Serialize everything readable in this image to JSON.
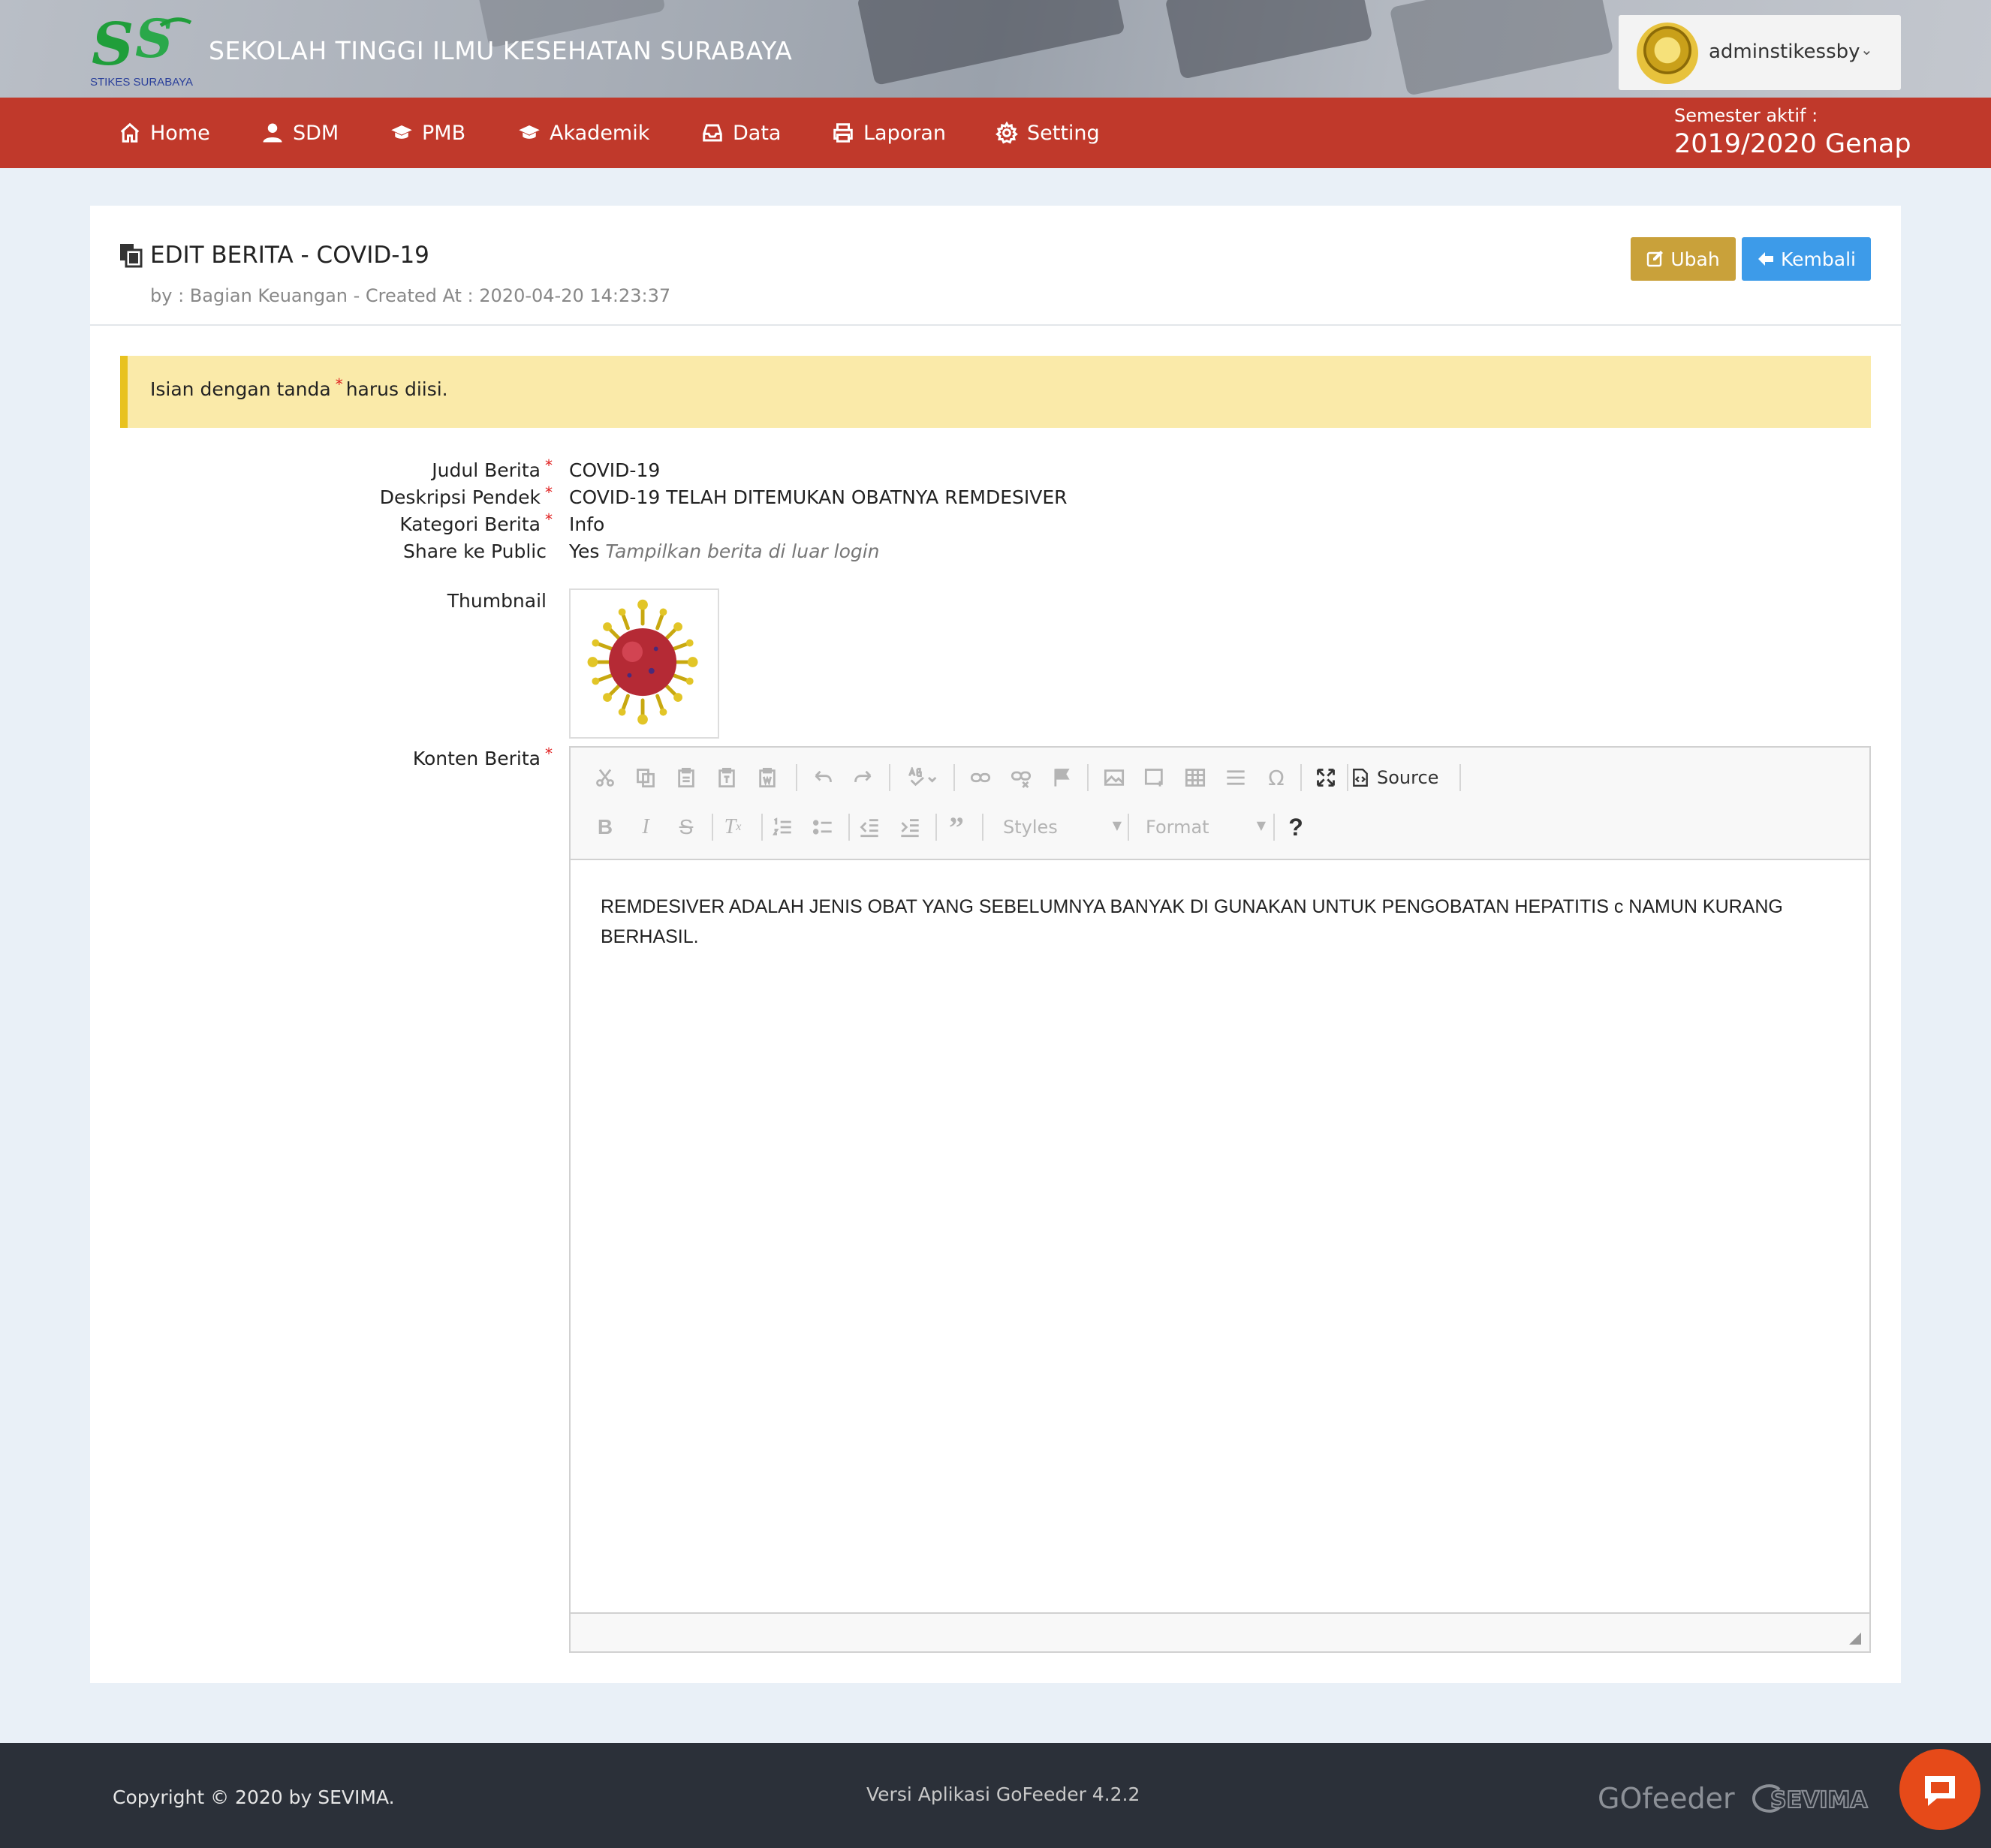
{
  "header": {
    "site_title": "SEKOLAH TINGGI ILMU KESEHATAN SURABAYA",
    "logo_text": "STIKES SURABAYA",
    "user": {
      "name": "adminstikessby",
      "caret": "⌄"
    }
  },
  "nav": {
    "items": [
      {
        "label": "Home",
        "icon": "home-icon"
      },
      {
        "label": "SDM",
        "icon": "user-icon"
      },
      {
        "label": "PMB",
        "icon": "graduation-cap-icon"
      },
      {
        "label": "Akademik",
        "icon": "graduation-cap-icon"
      },
      {
        "label": "Data",
        "icon": "inbox-icon"
      },
      {
        "label": "Laporan",
        "icon": "printer-icon"
      },
      {
        "label": "Setting",
        "icon": "gear-icon"
      }
    ],
    "semester_label": "Semester aktif :",
    "semester_value": "2019/2020 Genap"
  },
  "page": {
    "title": "EDIT BERITA - COVID-19",
    "subtitle": "by : Bagian Keuangan - Created At : 2020-04-20 14:23:37",
    "buttons": {
      "ubah": "Ubah",
      "kembali": "Kembali"
    },
    "alert": {
      "before": "Isian dengan tanda",
      "marker": "*",
      "after": "harus diisi."
    }
  },
  "form": {
    "judul": {
      "label": "Judul Berita",
      "value": "COVID-19"
    },
    "deskripsi": {
      "label": "Deskripsi Pendek",
      "value": "COVID-19 TELAH DITEMUKAN OBATNYA REMDESIVER"
    },
    "kategori": {
      "label": "Kategori Berita",
      "value": "Info"
    },
    "share": {
      "label": "Share ke Public",
      "value": "Yes",
      "hint": "Tampilkan berita di luar login"
    },
    "thumbnail": {
      "label": "Thumbnail"
    },
    "konten": {
      "label": "Konten Berita"
    },
    "required_marker": "*"
  },
  "editor": {
    "source_label": "Source",
    "styles_label": "Styles",
    "format_label": "Format",
    "help_label": "?",
    "content": "REMDESIVER ADALAH JENIS OBAT YANG SEBELUMNYA BANYAK DI GUNAKAN UNTUK PENGOBATAN HEPATITIS c NAMUN KURANG BERHASIL."
  },
  "footer": {
    "copyright": "Copyright © 2020 by SEVIMA.",
    "version": "Versi Aplikasi GoFeeder 4.2.2",
    "brand1": "GOfeeder",
    "brand2": "SEVIMA"
  },
  "colors": {
    "navbar": "#c0392b",
    "btn_ubah": "#c9a13a",
    "btn_kembali": "#3d9be9",
    "alert_bg": "#faeaa9",
    "footer_bg": "#2b3039"
  }
}
